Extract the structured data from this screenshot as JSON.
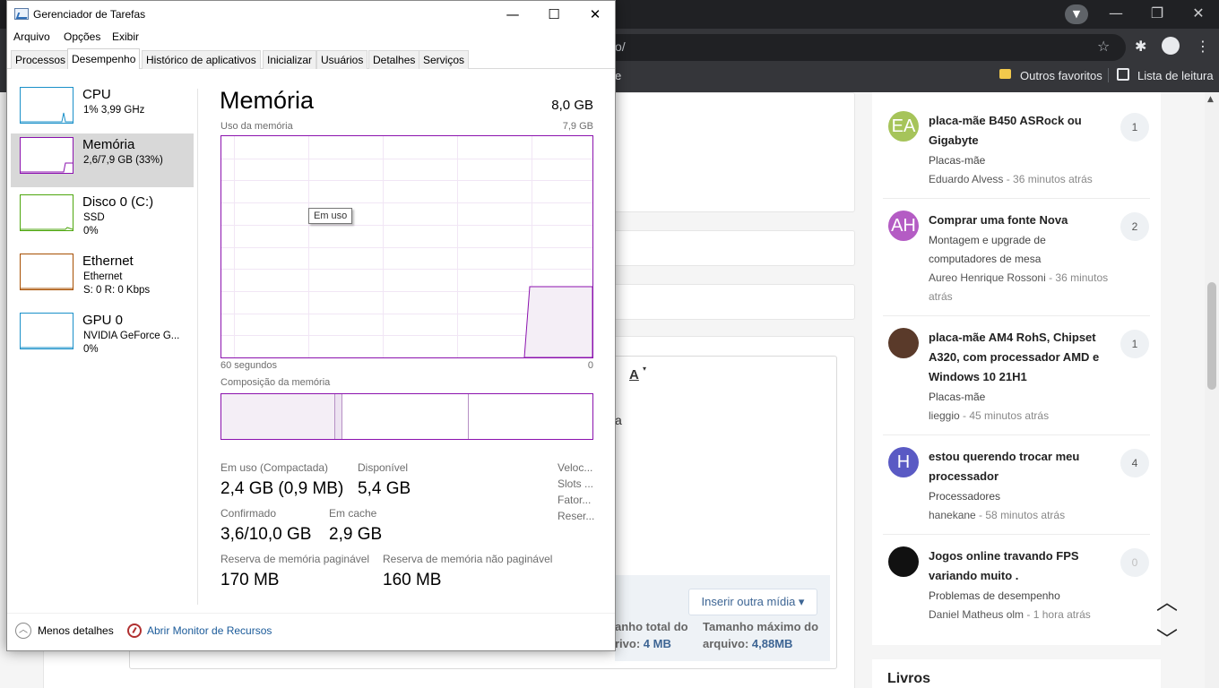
{
  "browser": {
    "url_fragment": "o/",
    "bookmark_stub": "e",
    "bookmarks": {
      "other_favorites": "Outros favoritos",
      "reading_list": "Lista de leitura"
    },
    "win_controls": {
      "minimize": "—",
      "restore": "❐",
      "close": "✕"
    },
    "profile_dropdown": "▼",
    "toolbar_icons": {
      "star": "☆",
      "extensions": "✱",
      "menu": "⋮"
    }
  },
  "forum": {
    "editor_text": "a",
    "editor_format": "A",
    "insert_media": "Inserir outra mídia ▾",
    "upload_total_label": "anho total do",
    "upload_total_value_label": "rivo:",
    "upload_total_value": "4 MB",
    "upload_max_label": "Tamanho máximo do",
    "upload_max_value_label": "arquivo:",
    "upload_max_value": "4,88MB",
    "livros": "Livros",
    "arrow_up": "︿",
    "arrow_down": "﹀",
    "feed": [
      {
        "initials": "EA",
        "avatar_color": "#a6c45a",
        "title": "placa-mãe B450 ASRock ou Gigabyte",
        "category": "Placas-mãe",
        "author": "Eduardo Alvess",
        "time": " - 36 minutos atrás",
        "count": "1"
      },
      {
        "initials": "AH",
        "avatar_color": "#b45cc4",
        "title": "Comprar uma fonte Nova",
        "category": "Montagem e upgrade de computadores de mesa",
        "author": "Aureo Henrique Rossoni",
        "time": " - 36 minutos atrás",
        "count": "2"
      },
      {
        "initials": "",
        "avatar_color": "#5a3a2a",
        "title": "placa-mãe AM4 RohS, Chipset A320, com processador AMD e Windows 10 21H1",
        "category": "Placas-mãe",
        "author": "lieggio",
        "time": " - 45 minutos atrás",
        "count": "1"
      },
      {
        "initials": "H",
        "avatar_color": "#5a5ac4",
        "title": "estou querendo trocar meu processador",
        "category": "Processadores",
        "author": "hanekane",
        "time": " - 58 minutos atrás",
        "count": "4"
      },
      {
        "initials": "",
        "avatar_color": "#111111",
        "title": "Jogos online travando FPS variando muito .",
        "category": "Problemas de desempenho",
        "author": "Daniel Matheus olm",
        "time": " - 1 hora atrás",
        "count": "0"
      }
    ]
  },
  "taskmgr": {
    "title": "Gerenciador de Tarefas",
    "win_controls": {
      "minimize": "—",
      "maximize": "☐",
      "close": "✕"
    },
    "menu": [
      "Arquivo",
      "Opções",
      "Exibir"
    ],
    "tabs": [
      "Processos",
      "Desempenho",
      "Histórico de aplicativos",
      "Inicializar",
      "Usuários",
      "Detalhes",
      "Serviços"
    ],
    "active_tab": "Desempenho",
    "resources": [
      {
        "name": "CPU",
        "line1": "1% 3,99 GHz",
        "line2": "",
        "graph_color": "#1a90c9"
      },
      {
        "name": "Memória",
        "line1": "2,6/7,9 GB (33%)",
        "line2": "",
        "graph_color": "#8b12ae"
      },
      {
        "name": "Disco 0 (C:)",
        "line1": "SSD",
        "line2": "0%",
        "graph_color": "#4da60c"
      },
      {
        "name": "Ethernet",
        "line1": "Ethernet",
        "line2": "S: 0 R: 0 Kbps",
        "graph_color": "#a74f01"
      },
      {
        "name": "GPU 0",
        "line1": "NVIDIA GeForce G...",
        "line2": "0%",
        "graph_color": "#1a90c9"
      }
    ],
    "memory": {
      "title": "Memória",
      "total": "8,0 GB",
      "usage_label": "Uso da memória",
      "usage_max": "7,9 GB",
      "time_label": "60 segundos",
      "time_end": "0",
      "tooltip": "Em uso",
      "composition_label": "Composição da memória",
      "usage_fraction": 0.32,
      "stats": {
        "in_use_label": "Em uso (Compactada)",
        "in_use_value": "2,4 GB (0,9 MB)",
        "available_label": "Disponível",
        "available_value": "5,4 GB",
        "committed_label": "Confirmado",
        "committed_value": "3,6/10,0 GB",
        "cached_label": "Em cache",
        "cached_value": "2,9 GB",
        "paged_label": "Reserva de memória paginável",
        "paged_value": "170 MB",
        "nonpaged_label": "Reserva de memória não paginável",
        "nonpaged_value": "160 MB"
      },
      "right_labels": [
        "Veloc...",
        "Slots ...",
        "Fator...",
        "Reser..."
      ]
    },
    "footer": {
      "less_details": "Menos detalhes",
      "less_icon": "︿",
      "resource_monitor": "Abrir Monitor de Recursos"
    }
  }
}
